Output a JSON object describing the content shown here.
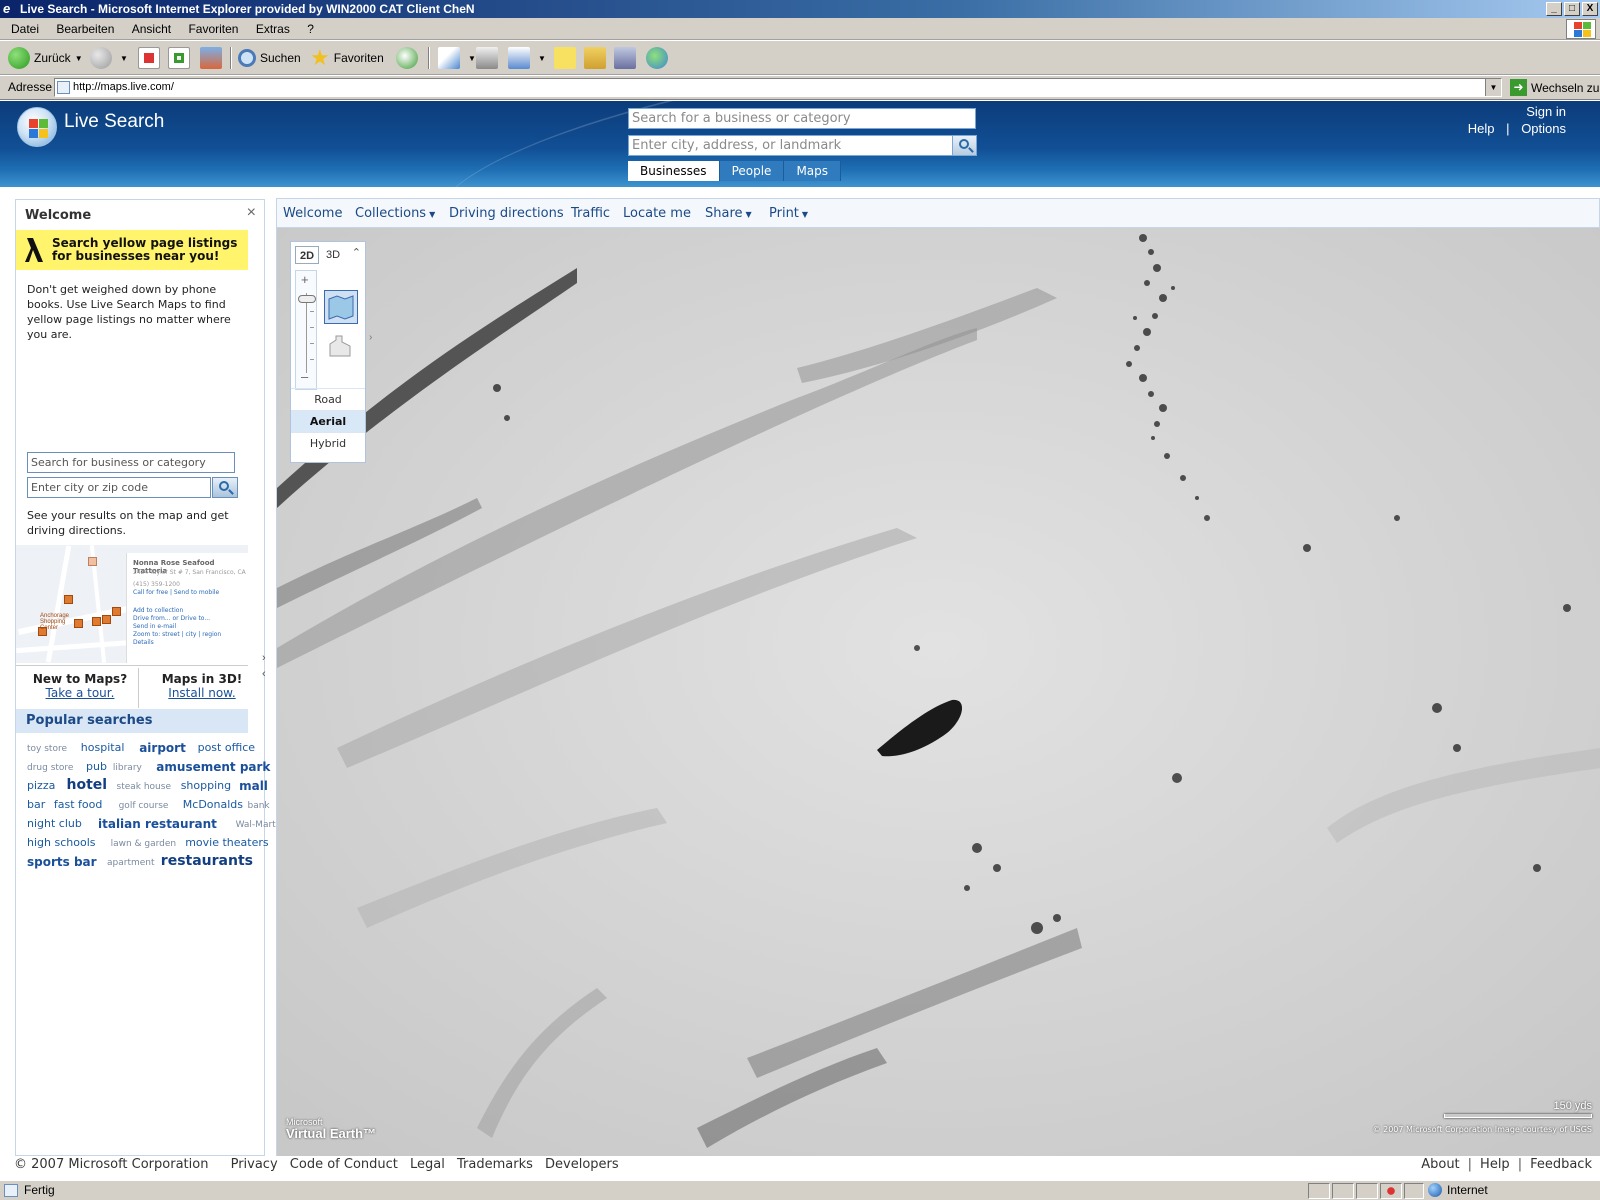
{
  "window": {
    "title": "Live Search - Microsoft Internet Explorer provided by WIN2000 CAT Client CheN",
    "buttons": [
      "_",
      "□",
      "X"
    ]
  },
  "menu": [
    "Datei",
    "Bearbeiten",
    "Ansicht",
    "Favoriten",
    "Extras",
    "?"
  ],
  "toolbar": {
    "back_label": "Zurück",
    "search_label": "Suchen",
    "favorites_label": "Favoriten"
  },
  "address": {
    "label": "Adresse",
    "url": "http://maps.live.com/",
    "go_label": "Wechseln zu"
  },
  "header": {
    "brand": "Live Search",
    "search_placeholder": "Search for a business or category",
    "where_placeholder": "Enter city, address, or landmark",
    "tabs": [
      "Businesses",
      "People",
      "Maps"
    ],
    "active_tab": "Businesses",
    "sign_in": "Sign in",
    "help": "Help",
    "sep": "|",
    "options": "Options"
  },
  "welcome": {
    "title": "Welcome",
    "close": "×",
    "yp_line1": "Search yellow page listings",
    "yp_line2": "for businesses near you!",
    "intro": "Don't get weighed down by phone books. Use Live Search Maps to find yellow page listings no matter where you are.",
    "biz_placeholder": "Search for business or category",
    "city_placeholder": "Enter city or zip code",
    "results_text": "See your results on the map and get driving directions.",
    "promo": {
      "card_title": "Nonna Rose Seafood Trattoria",
      "card_addr": "2424 Taylor St # 7, San Francisco, CA",
      "card_phone": "(415) 359-1200",
      "card_call": "Call for free | Send to mobile",
      "card_links": [
        "Add to collection",
        "Drive from... or Drive to...",
        "Send in e-mail",
        "Zoom to: street | city | region",
        "Details"
      ],
      "map_label": "Anchorage Shopping Center"
    },
    "new_title": "New to Maps?",
    "new_link": "Take a tour.",
    "three_d_title": "Maps in 3D!",
    "three_d_link": "Install now.",
    "popular_title": "Popular searches",
    "tags": [
      {
        "t": "toy store",
        "s": "s"
      },
      {
        "t": "hospital",
        "s": "m"
      },
      {
        "t": "airport",
        "s": "l"
      },
      {
        "t": "post office",
        "s": "m"
      },
      {
        "t": "drug store",
        "s": "s"
      },
      {
        "t": "pub",
        "s": "m"
      },
      {
        "t": "library",
        "s": "s"
      },
      {
        "t": "amusement park",
        "s": "l"
      },
      {
        "t": "pizza",
        "s": "m"
      },
      {
        "t": "hotel",
        "s": "xl"
      },
      {
        "t": "steak house",
        "s": "s"
      },
      {
        "t": "shopping",
        "s": "m"
      },
      {
        "t": "mall",
        "s": "l"
      },
      {
        "t": "bar",
        "s": "m"
      },
      {
        "t": "fast food",
        "s": "m"
      },
      {
        "t": "golf course",
        "s": "s"
      },
      {
        "t": "McDonalds",
        "s": "m"
      },
      {
        "t": "bank",
        "s": "s"
      },
      {
        "t": "night club",
        "s": "m"
      },
      {
        "t": "italian restaurant",
        "s": "l"
      },
      {
        "t": "Wal-Mart",
        "s": "s"
      },
      {
        "t": "high schools",
        "s": "m"
      },
      {
        "t": "lawn & garden",
        "s": "s"
      },
      {
        "t": "movie theaters",
        "s": "m"
      },
      {
        "t": "sports bar",
        "s": "l"
      },
      {
        "t": "apartment",
        "s": "s"
      },
      {
        "t": "restaurants",
        "s": "xl"
      }
    ]
  },
  "mapnav": {
    "items": [
      "Welcome",
      "Collections",
      "Driving directions",
      "Traffic",
      "Locate me",
      "Share",
      "Print"
    ]
  },
  "map_control": {
    "view_2d": "2D",
    "view_3d": "3D",
    "styles": [
      "Road",
      "Aerial",
      "Hybrid"
    ],
    "active_style": "Aerial"
  },
  "map_overlay": {
    "logo_small": "Microsoft",
    "logo": "Virtual Earth™",
    "scale": "150 yds",
    "copyright": "© 2007 Microsoft Corporation  Image courtesy of USGS"
  },
  "footer": {
    "copyright": "© 2007 Microsoft Corporation",
    "links_left": [
      "Privacy",
      "Code of Conduct",
      "Legal",
      "Trademarks",
      "Developers"
    ],
    "links_right": [
      "About",
      "Help",
      "Feedback"
    ]
  },
  "status": {
    "text": "Fertig",
    "zone": "Internet"
  },
  "colors": {
    "header_blue": "#114f95",
    "link_blue": "#1b4a86",
    "yellow_banner": "#fff46b",
    "tab_blue": "#2f7bbd"
  }
}
